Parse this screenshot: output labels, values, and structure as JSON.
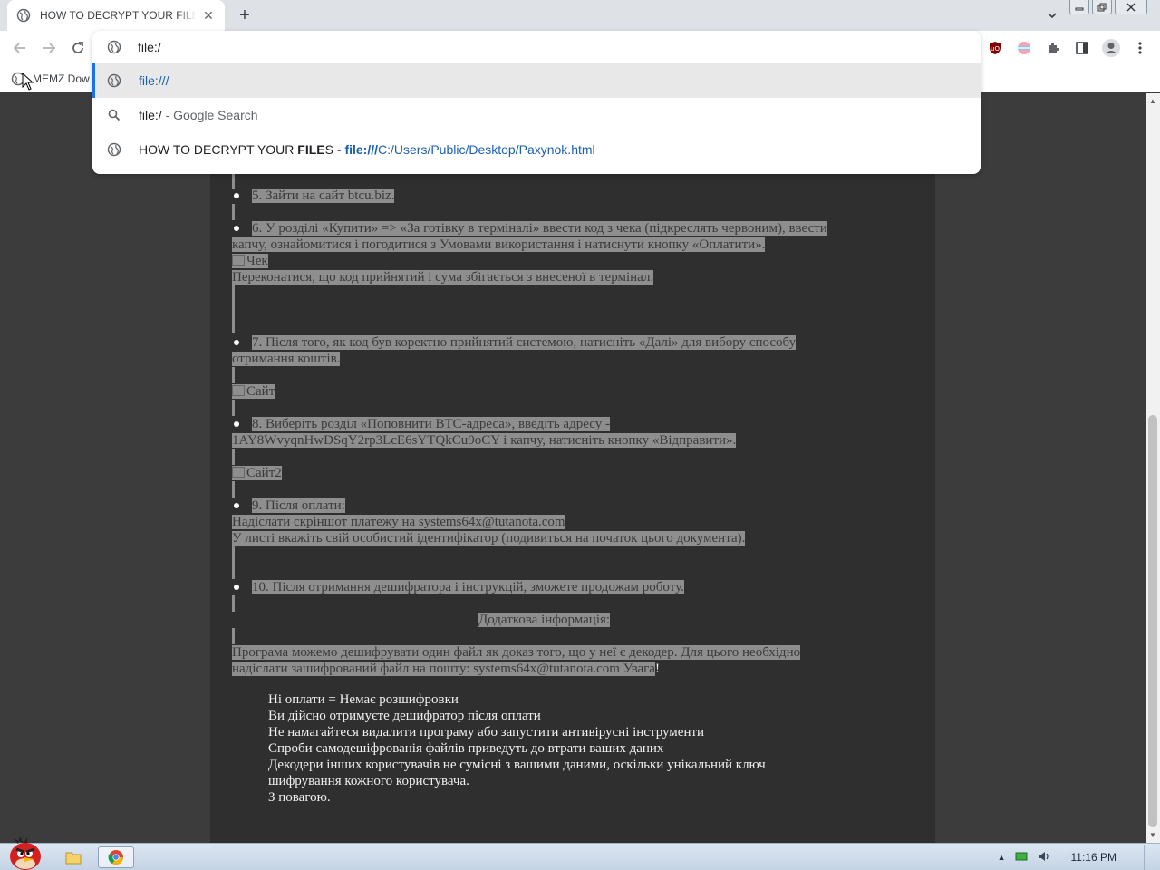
{
  "browser": {
    "tab_title": "HOW TO DECRYPT YOUR FILES",
    "tab_close": "✕",
    "new_tab": "+",
    "bookmark_label": "MEMZ Dow"
  },
  "omnibox": {
    "input_value": "file:/",
    "suggestions": [
      {
        "icon": "globe-icon",
        "text": "file:///"
      },
      {
        "icon": "search-icon",
        "query": "file:/",
        "suffix": " - Google Search"
      },
      {
        "icon": "globe-icon",
        "title_prefix": "HOW TO DECRYPT YOUR ",
        "title_bold": "FILE",
        "title_suffix": "S",
        "separator": " - ",
        "url_bold": "file:///",
        "url_rest": "C:/Users/Public/Desktop/Paxynok.html"
      }
    ]
  },
  "page": {
    "step5": "5. Зайти на сайт btcu.biz.",
    "step6_l1": "6. У розділі «Купити» => «За готівку в терміналі» ввести код з чека (підкреслять червоним), ввести",
    "step6_l2": "капчу, ознайомитися і погодитися з Умовами використання і натиснути кнопку «Оплатити».",
    "img_check": "Чек",
    "step6_l3": "Переконатися, що код прийнятий і сума збігається з внесеної в термінал.",
    "step7_l1": "7. Після того, як код був коректно прийнятий системою, натисніть «Далі» для вибору способу",
    "step7_l2": "отримання коштів.",
    "img_site": "Сайт",
    "step8_l1": "8. Виберіть розділ «Поповнити BTC-адреса», введіть адресу -",
    "step8_l2": "1AY8WvyqnHwDSqY2rp3LcE6sYTQkCu9oCY і капчу, натисніть кнопку «Відправити».",
    "img_site2": "Сайт2",
    "step9_l1": "9. Після оплати:",
    "step9_l2": "Надіслати скріншот платежу на systems64x@tutanota.com",
    "step9_l3": "У листі вкажіть свій особистий ідентифікатор (подивиться на початок цього документа).",
    "step10": "10. Після отримання дешифратора і інструкцій, зможете продожам роботу.",
    "extra_heading": "Додаткова інформація:",
    "extra_l1": "Програма можемо дешифрувати один файл як доказ того, що у неї є декодер. Для цього необхідно",
    "extra_l2": "надіслати зашифрований файл на пошту: systems64x@tutanota.com Увага",
    "extra_l2_tail": "!",
    "warn1": "Ні оплати = Немає розшифровки",
    "warn2": "Ви дійсно отримуєте дешифратор після оплати",
    "warn3": "Не намагайтеся видалити програму або запустити антивірусні інструменти",
    "warn4": "Спроби самодешіфрованія файлів приведуть до втрати ваших даних",
    "warn5": "Декодери інших користувачів не сумісні з вашими даними, оскільки унікальний ключ",
    "warn6": "шифрування кожного користувача.",
    "warn7": "З повагою."
  },
  "taskbar": {
    "clock": "11:16 PM"
  }
}
